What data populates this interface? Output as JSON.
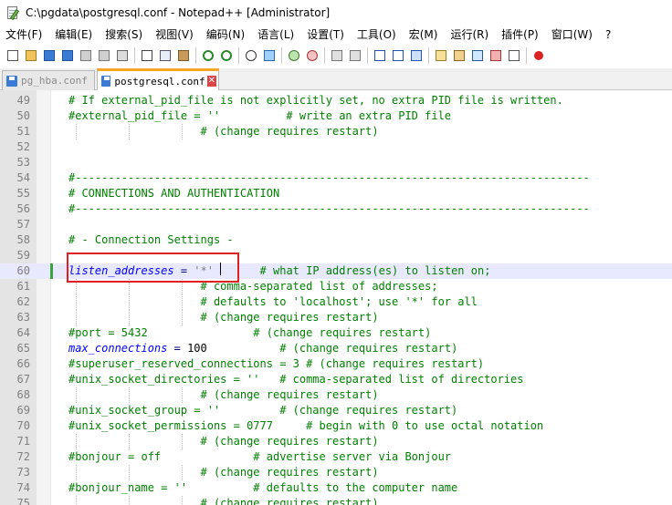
{
  "window": {
    "title": "C:\\pgdata\\postgresql.conf - Notepad++ [Administrator]"
  },
  "menu": [
    "文件(F)",
    "编辑(E)",
    "搜索(S)",
    "视图(V)",
    "编码(N)",
    "语言(L)",
    "设置(T)",
    "工具(O)",
    "宏(M)",
    "运行(R)",
    "插件(P)",
    "窗口(W)",
    "?"
  ],
  "toolbar_icons": [
    "new-file-icon",
    "open-file-icon",
    "save-icon",
    "save-all-icon",
    "close-icon",
    "close-all-icon",
    "print-icon",
    "cut-icon",
    "copy-icon",
    "paste-icon",
    "undo-icon",
    "redo-icon",
    "find-icon",
    "replace-icon",
    "zoom-in-icon",
    "zoom-out-icon",
    "sync-vertical-icon",
    "sync-horizontal-icon",
    "word-wrap-icon",
    "show-all-chars-icon",
    "indent-guide-icon",
    "udl-icon",
    "doc-map-icon",
    "function-list-icon",
    "folder-as-workspace-icon",
    "monitoring-icon",
    "record-macro-icon"
  ],
  "tabs": [
    {
      "label": "pg_hba.conf",
      "active": false
    },
    {
      "label": "postgresql.conf",
      "active": true
    }
  ],
  "editor": {
    "current_line": 60,
    "lines": [
      {
        "n": "49",
        "text": "# If external_pid_file is not explicitly set, no extra PID file is written."
      },
      {
        "n": "50",
        "text": "#external_pid_file = ''          # write an extra PID file"
      },
      {
        "n": "51",
        "text": "                    # (change requires restart)"
      },
      {
        "n": "52",
        "text": ""
      },
      {
        "n": "53",
        "text": ""
      },
      {
        "n": "54",
        "text": "#------------------------------------------------------------------------------"
      },
      {
        "n": "55",
        "text": "# CONNECTIONS AND AUTHENTICATION"
      },
      {
        "n": "56",
        "text": "#------------------------------------------------------------------------------"
      },
      {
        "n": "57",
        "text": ""
      },
      {
        "n": "58",
        "text": "# - Connection Settings -"
      },
      {
        "n": "59",
        "text": ""
      },
      {
        "n": "60",
        "text": "listen_addresses = '*'       # what IP address(es) to listen on;"
      },
      {
        "n": "61",
        "text": "                    # comma-separated list of addresses;"
      },
      {
        "n": "62",
        "text": "                    # defaults to 'localhost'; use '*' for all"
      },
      {
        "n": "63",
        "text": "                    # (change requires restart)"
      },
      {
        "n": "64",
        "text": "#port = 5432                # (change requires restart)"
      },
      {
        "n": "65",
        "text": "max_connections = 100           # (change requires restart)"
      },
      {
        "n": "66",
        "text": "#superuser_reserved_connections = 3 # (change requires restart)"
      },
      {
        "n": "67",
        "text": "#unix_socket_directories = ''   # comma-separated list of directories"
      },
      {
        "n": "68",
        "text": "                    # (change requires restart)"
      },
      {
        "n": "69",
        "text": "#unix_socket_group = ''         # (change requires restart)"
      },
      {
        "n": "70",
        "text": "#unix_socket_permissions = 0777     # begin with 0 to use octal notation"
      },
      {
        "n": "71",
        "text": "                    # (change requires restart)"
      },
      {
        "n": "72",
        "text": "#bonjour = off              # advertise server via Bonjour"
      },
      {
        "n": "73",
        "text": "                    # (change requires restart)"
      },
      {
        "n": "74",
        "text": "#bonjour_name = ''          # defaults to the computer name"
      },
      {
        "n": "75",
        "text": "                    # (change requires restart)"
      }
    ]
  },
  "colors": {
    "comment": "#008000",
    "keyword": "#0000ff",
    "operator": "#000080",
    "string": "#808080",
    "current_line": "#e8e8ff",
    "highlight_box": "#e02020",
    "tab_accent": "#f5a623",
    "change_mark": "#3aa33a"
  }
}
